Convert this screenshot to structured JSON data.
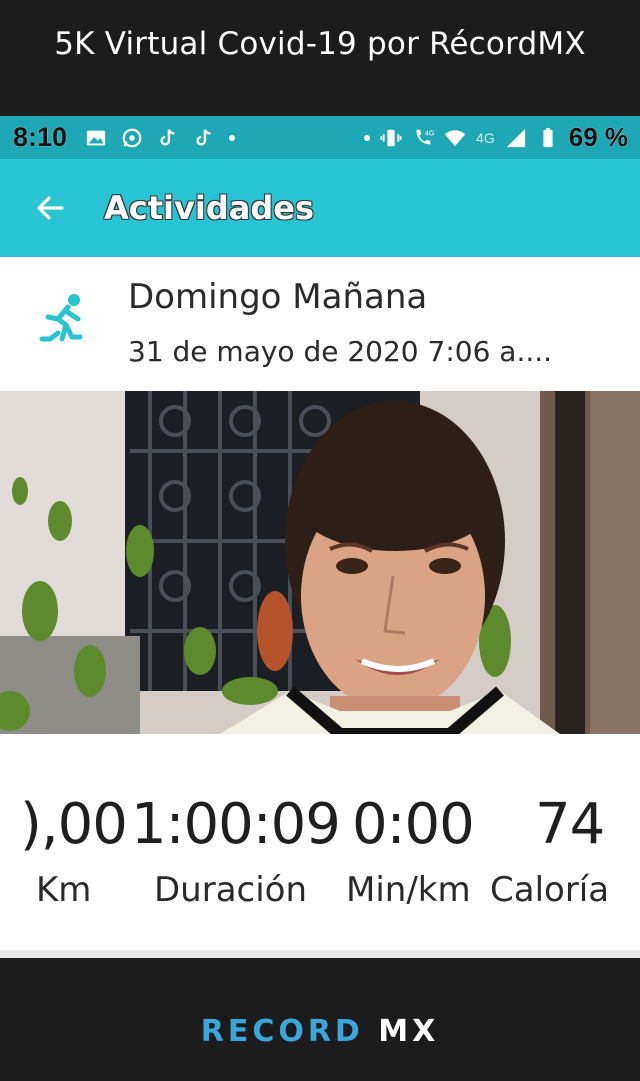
{
  "banner": {
    "title": "5K Virtual Covid-19 por RécordMX"
  },
  "status_bar": {
    "time": "8:10",
    "battery": "69 %",
    "network_1": "4G",
    "network_2": "4G"
  },
  "app_bar": {
    "title": "Actividades"
  },
  "activity": {
    "name": "Domingo Mañana",
    "date": "31 de mayo de 2020 7:06 a...."
  },
  "stats": [
    {
      "value": "),00",
      "label": "Km"
    },
    {
      "value": "1:00:09",
      "label": "Duración"
    },
    {
      "value": "0:00",
      "label": "Min/km"
    },
    {
      "value": "74",
      "label": "Caloría"
    }
  ],
  "footer": {
    "brand_part1": "RECORD",
    "brand_part2": " MX"
  },
  "colors": {
    "app_bar": "#29c4d3",
    "status_bar": "#1ea8b6",
    "accent": "#29c4d3",
    "brand_blue": "#3aa6d9"
  }
}
